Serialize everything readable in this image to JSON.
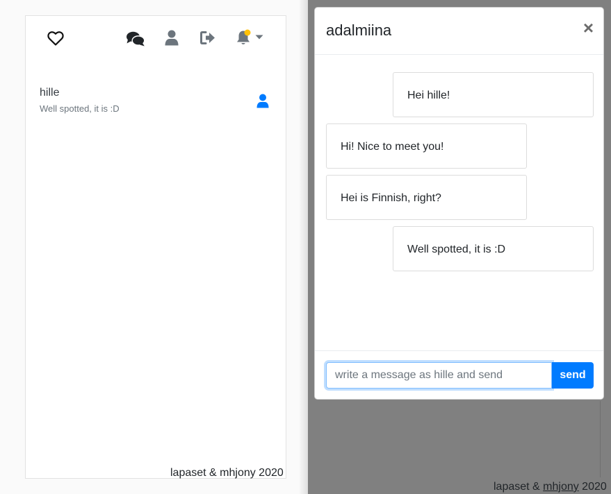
{
  "nav": {
    "icons": [
      "heart-icon",
      "comments-icon",
      "user-icon",
      "sign-out-icon",
      "bell-icon",
      "caret-down-icon"
    ],
    "badge_color": "#ffc107"
  },
  "conversation": {
    "name": "hille",
    "last_message": "Well spotted, it is :D"
  },
  "footer": {
    "credit": "lapaset & mhjony 2020",
    "credit_prefix": "lapaset & ",
    "credit_link": "mhjony",
    "credit_suffix": " 2020"
  },
  "modal": {
    "title": "adalmiina",
    "close_label": "×",
    "messages": [
      {
        "text": "Hei hille!",
        "side": "right"
      },
      {
        "text": "Hi! Nice to meet you!",
        "side": "left"
      },
      {
        "text": "Hei is Finnish, right?",
        "side": "left"
      },
      {
        "text": "Well spotted, it is :D",
        "side": "right"
      }
    ],
    "input_placeholder": "write a message as hille and send",
    "send_label": "send"
  },
  "colors": {
    "primary": "#007bff",
    "backdrop": "#808080",
    "icon_dark": "#212529",
    "icon_gray": "#6c757d"
  }
}
